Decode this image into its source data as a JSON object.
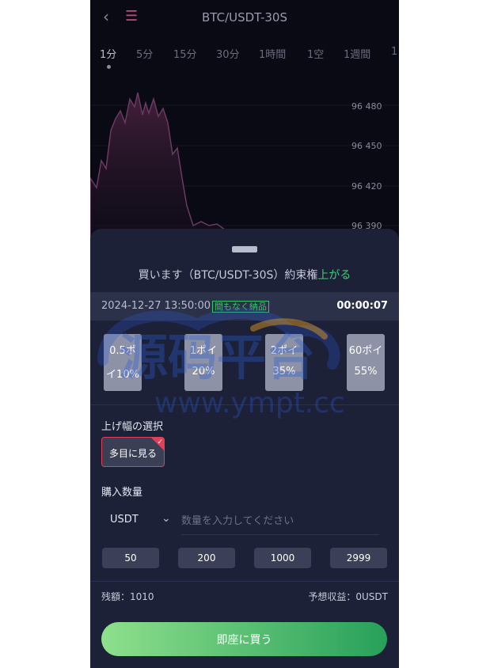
{
  "header": {
    "title": "BTC/USDT-30S",
    "back_icon": "chevron-left-icon",
    "menu_icon": "menu-icon"
  },
  "tabs": [
    "1分",
    "5分",
    "15分",
    "30分",
    "1時間",
    "1空",
    "1週間",
    "1"
  ],
  "active_tab": 0,
  "price_axis": [
    "96 480",
    "96 450",
    "96 420",
    "96 390"
  ],
  "order_sheet": {
    "buy_prefix": "買います（BTC/USDT-30S）約束権",
    "buy_direction": "上がる",
    "datetime": "2024-12-27 13:50:00",
    "status_badge": "間もなく納品",
    "countdown": "00:00:07",
    "options": [
      {
        "line1": "0.5ポ",
        "line2": "イ10%"
      },
      {
        "line1": "1ポイ",
        "line2": "20%"
      },
      {
        "line1": "2ポイ",
        "line2": "35%"
      },
      {
        "line1": "60ポイ",
        "line2": "55%"
      }
    ],
    "range_label": "上げ幅の選択",
    "range_chip": "多目に見る",
    "qty_label": "購入数量",
    "currency": "USDT",
    "qty_placeholder": "数量を入力してください",
    "quick_amounts": [
      "50",
      "200",
      "1000",
      "2999"
    ],
    "balance": "残額：1010",
    "expected": "予想収益：0USDT",
    "buy_button": "即座に買う"
  },
  "watermark": {
    "brand": "源码平台",
    "url": "www.ympt.cc"
  },
  "colors": {
    "up": "#3ed06f",
    "accent_red": "#e0405a",
    "sheet_bg": "#1c2138",
    "button_start": "#8ee08c",
    "button_end": "#27a05a"
  }
}
